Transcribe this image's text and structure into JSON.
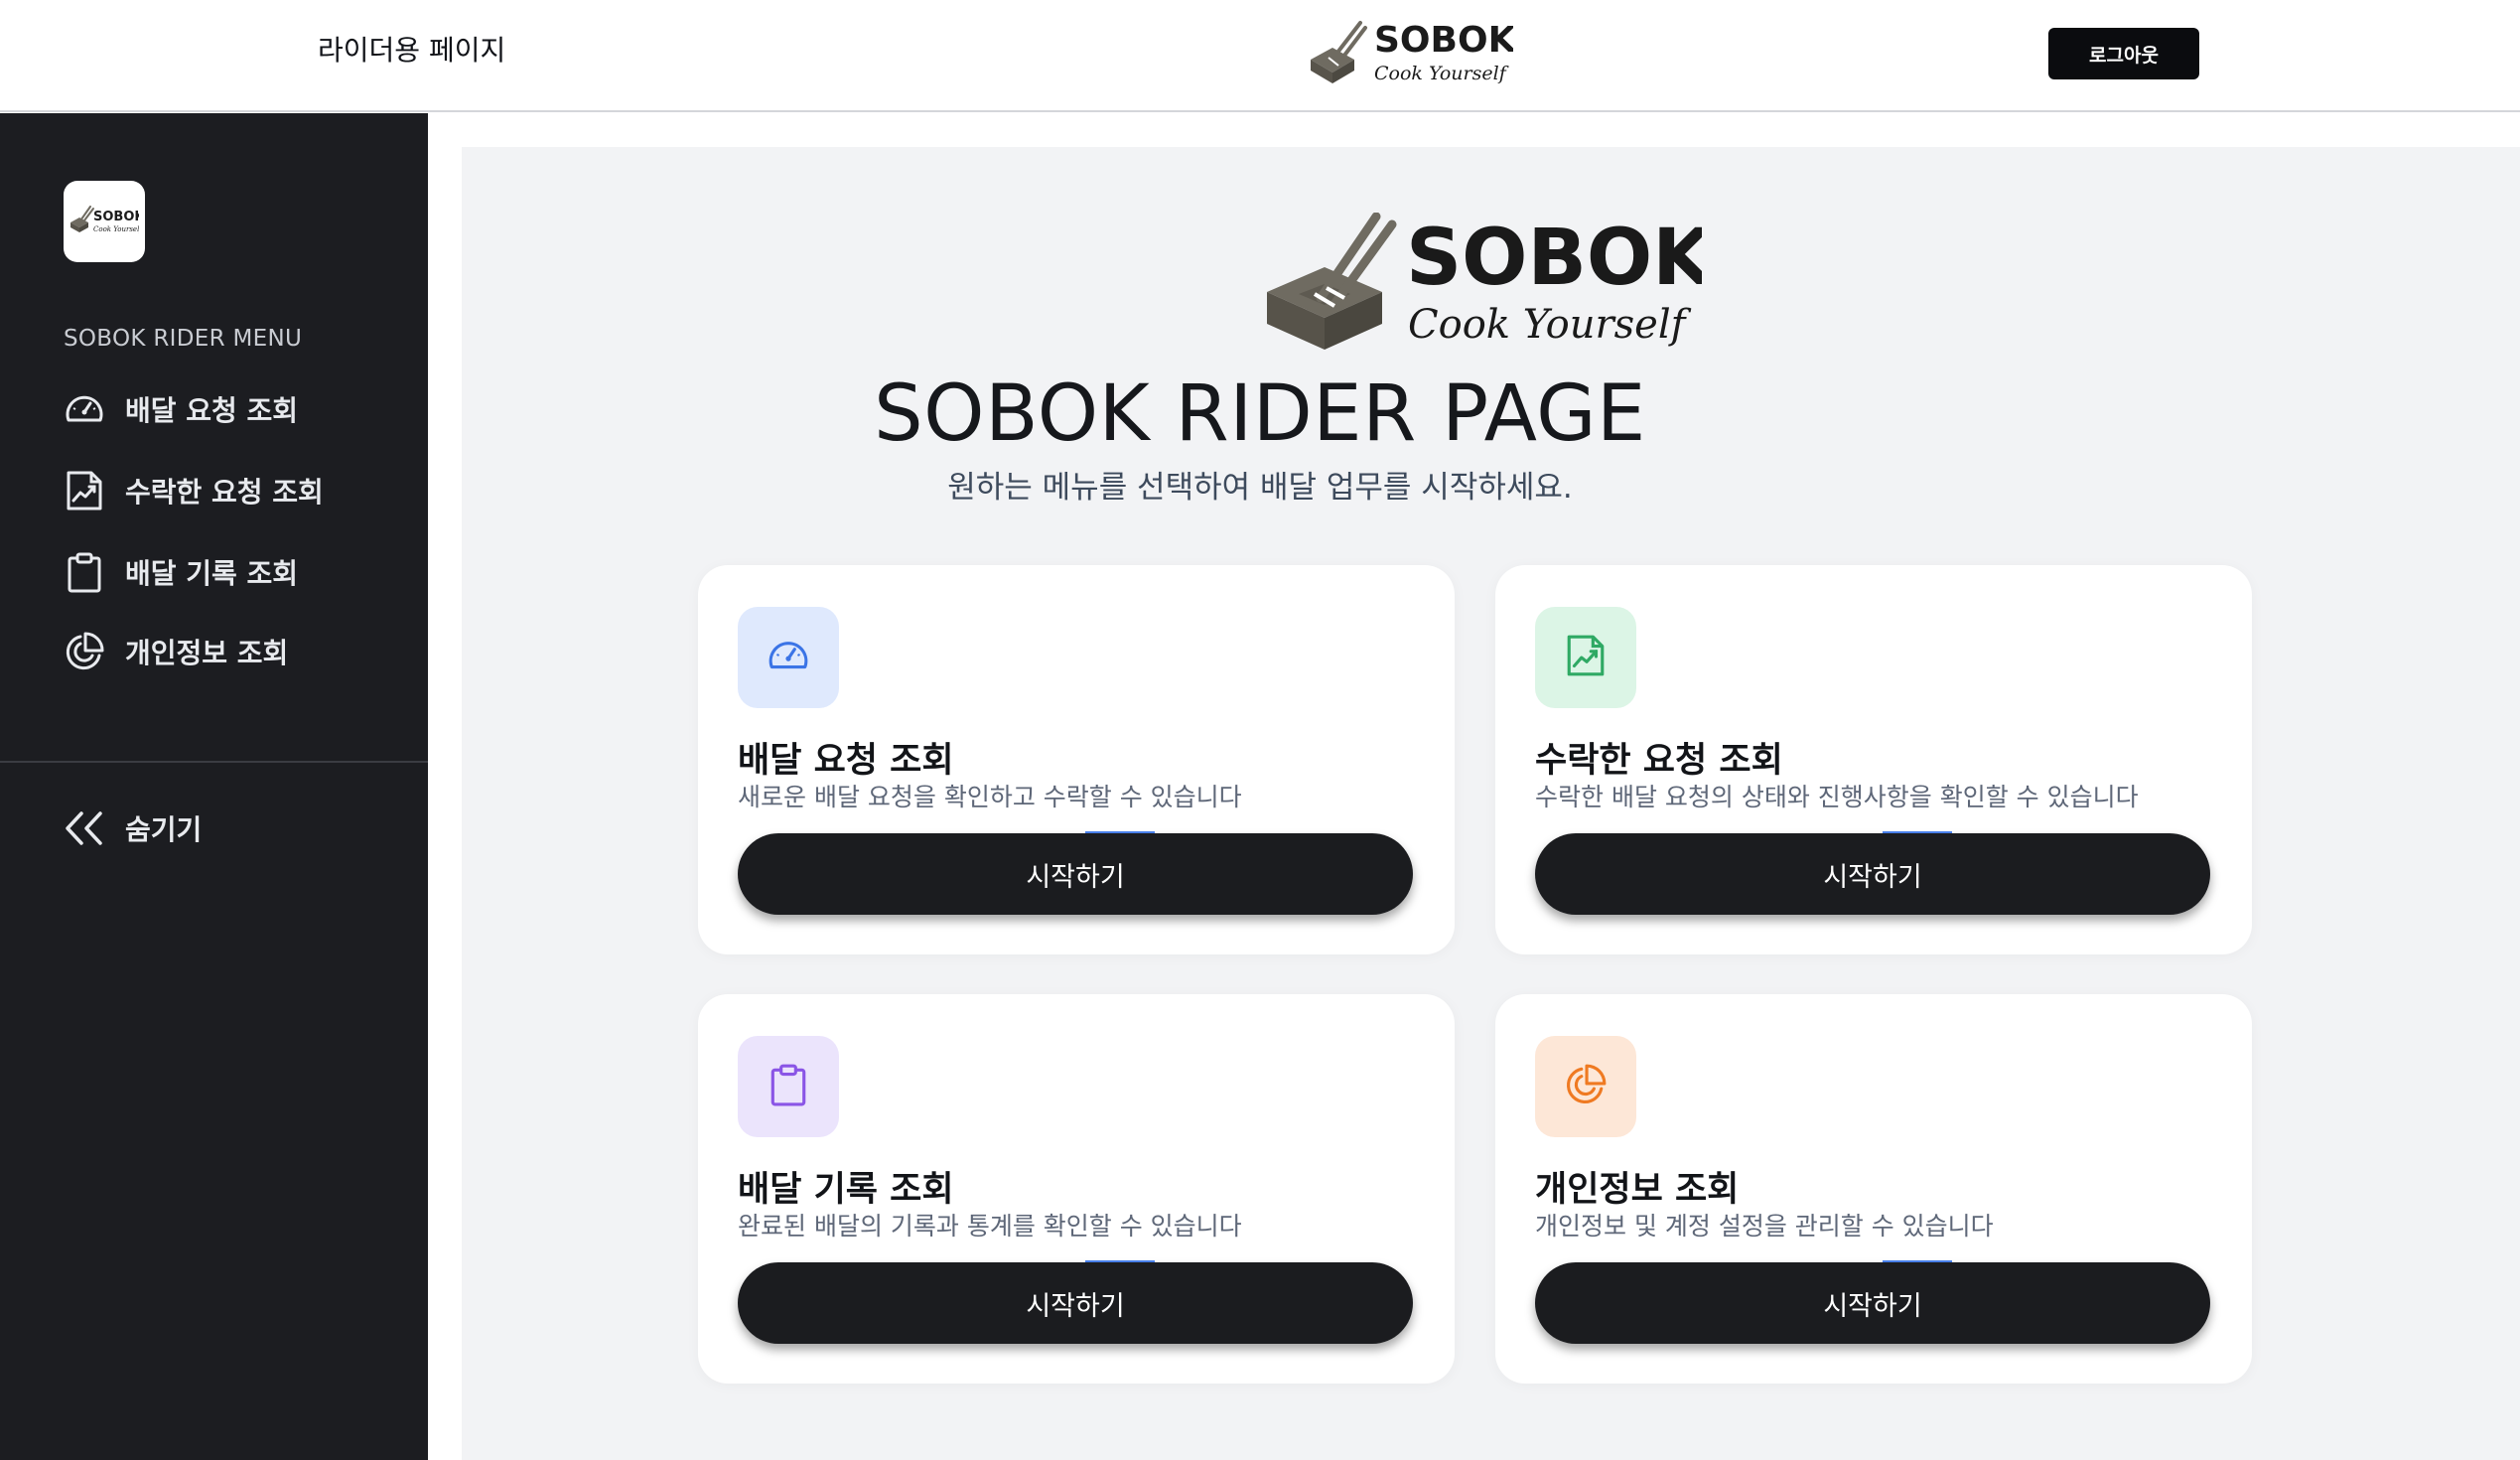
{
  "header": {
    "title": "라이더용 페이지",
    "logout_label": "로그아웃"
  },
  "brand": {
    "name": "SOBOK",
    "tagline": "Cook Yourself"
  },
  "sidebar": {
    "heading": "SOBOK RIDER MENU",
    "items": [
      {
        "label": "배달 요청 조회",
        "icon": "dashboard-gauge-icon"
      },
      {
        "label": "수락한 요청 조회",
        "icon": "chart-document-icon"
      },
      {
        "label": "배달 기록 조회",
        "icon": "clipboard-icon"
      },
      {
        "label": "개인정보 조회",
        "icon": "pie-chart-icon"
      }
    ],
    "hide_label": "숨기기"
  },
  "hero": {
    "title": "SOBOK RIDER PAGE",
    "subtitle": "원하는 메뉴를 선택하여 배달 업무를 시작하세요."
  },
  "cards": [
    {
      "title": "배달 요청 조회",
      "desc": "새로운 배달 요청을 확인하고 수락할 수 있습니다",
      "button": "시작하기",
      "icon": "dashboard-gauge-icon",
      "tile_color": "#dfe9fd",
      "icon_color": "#3b74e6"
    },
    {
      "title": "수락한 요청 조회",
      "desc": "수락한 배달 요청의 상태와 진행사항을 확인할 수 있습니다",
      "button": "시작하기",
      "icon": "chart-document-icon",
      "tile_color": "#dcf5e6",
      "icon_color": "#2fa964"
    },
    {
      "title": "배달 기록 조회",
      "desc": "완료된 배달의 기록과 통계를 확인할 수 있습니다",
      "button": "시작하기",
      "icon": "clipboard-icon",
      "tile_color": "#ebe4fc",
      "icon_color": "#8a55e6"
    },
    {
      "title": "개인정보 조회",
      "desc": "개인정보 및 계정 설정을 관리할 수 있습니다",
      "button": "시작하기",
      "icon": "pie-chart-icon",
      "tile_color": "#fde7d7",
      "icon_color": "#ef7a22"
    }
  ],
  "colors": {
    "sidebar_bg": "#1c1d21",
    "panel_bg": "#f2f3f5",
    "button_bg": "#1b1c1f",
    "logo_gray": "#6f6b61"
  }
}
